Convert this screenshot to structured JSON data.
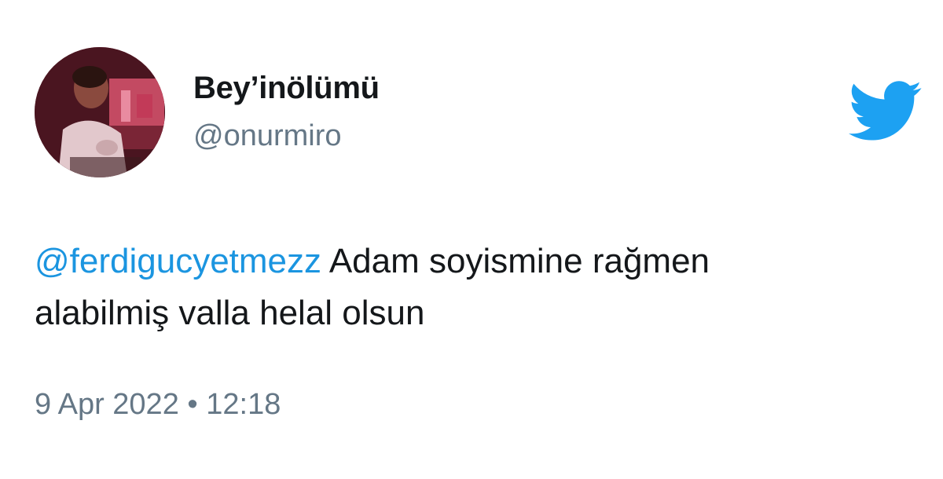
{
  "tweet": {
    "display_name": "Bey’inölümü",
    "username": "@onurmiro",
    "mention": "@ferdigucyetmezz",
    "text_part1": " Adam soyismine rağmen",
    "text_part2": "alabilmiş valla helal olsun",
    "timestamp": "9 Apr 2022 • 12:18"
  },
  "icons": {
    "brand": "twitter-bird-icon",
    "avatar": "profile-photo"
  },
  "colors": {
    "text": "#14171a",
    "secondary": "#657786",
    "link": "#1b95e0",
    "brand": "#1da1f2",
    "background": "#ffffff"
  }
}
